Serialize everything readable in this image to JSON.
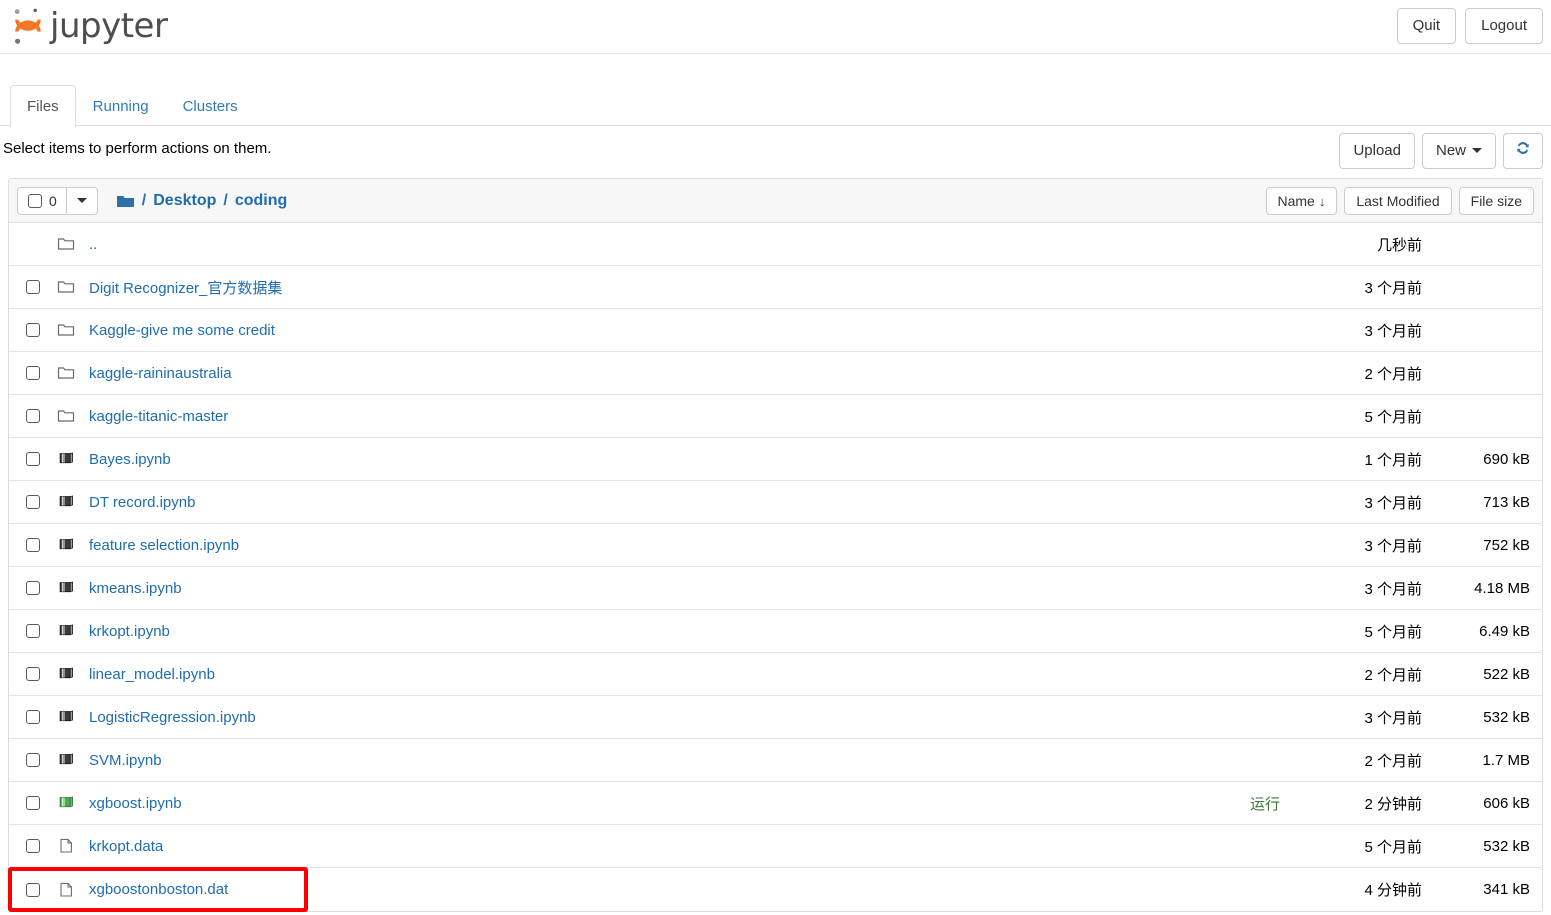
{
  "header": {
    "brand": "jupyter",
    "logo_color": "#f37726",
    "quit_label": "Quit",
    "logout_label": "Logout"
  },
  "tabs": [
    {
      "label": "Files",
      "active": true
    },
    {
      "label": "Running",
      "active": false
    },
    {
      "label": "Clusters",
      "active": false
    }
  ],
  "action_bar": {
    "message": "Select items to perform actions on them.",
    "upload_label": "Upload",
    "new_label": "New",
    "refresh_icon": "refresh-icon"
  },
  "list_toolbar": {
    "select_count": "0",
    "select_checkbox_icon": "checkbox-icon",
    "dropdown_icon": "chevron-down-icon",
    "breadcrumb": {
      "home_icon": "folder-icon",
      "items": [
        "Desktop",
        "coding"
      ],
      "separator": "/"
    },
    "sort_buttons": [
      {
        "label": "Name",
        "arrow": "↓"
      },
      {
        "label": "Last Modified",
        "arrow": ""
      },
      {
        "label": "File size",
        "arrow": ""
      }
    ]
  },
  "colors": {
    "link": "#1f6cb0",
    "running": "#3c763d",
    "highlight": "#ff0000",
    "notebook_icon": "#3b3b3b",
    "notebook_running_icon": "#4caf50",
    "brand_orange": "#f37726"
  },
  "files": [
    {
      "checkbox": false,
      "icon": "folder-icon",
      "name": "..",
      "running": "",
      "modified": "几秒前",
      "size": "",
      "parent": true,
      "highlighted": false
    },
    {
      "checkbox": true,
      "icon": "folder-icon",
      "name": "Digit Recognizer_官方数据集",
      "running": "",
      "modified": "3 个月前",
      "size": "",
      "parent": false,
      "highlighted": false
    },
    {
      "checkbox": true,
      "icon": "folder-icon",
      "name": "Kaggle-give me some credit",
      "running": "",
      "modified": "3 个月前",
      "size": "",
      "parent": false,
      "highlighted": false
    },
    {
      "checkbox": true,
      "icon": "folder-icon",
      "name": "kaggle-raininaustralia",
      "running": "",
      "modified": "2 个月前",
      "size": "",
      "parent": false,
      "highlighted": false
    },
    {
      "checkbox": true,
      "icon": "folder-icon",
      "name": "kaggle-titanic-master",
      "running": "",
      "modified": "5 个月前",
      "size": "",
      "parent": false,
      "highlighted": false
    },
    {
      "checkbox": true,
      "icon": "notebook-icon",
      "name": "Bayes.ipynb",
      "running": "",
      "modified": "1 个月前",
      "size": "690 kB",
      "parent": false,
      "highlighted": false
    },
    {
      "checkbox": true,
      "icon": "notebook-icon",
      "name": "DT record.ipynb",
      "running": "",
      "modified": "3 个月前",
      "size": "713 kB",
      "parent": false,
      "highlighted": false
    },
    {
      "checkbox": true,
      "icon": "notebook-icon",
      "name": "feature selection.ipynb",
      "running": "",
      "modified": "3 个月前",
      "size": "752 kB",
      "parent": false,
      "highlighted": false
    },
    {
      "checkbox": true,
      "icon": "notebook-icon",
      "name": "kmeans.ipynb",
      "running": "",
      "modified": "3 个月前",
      "size": "4.18 MB",
      "parent": false,
      "highlighted": false
    },
    {
      "checkbox": true,
      "icon": "notebook-icon",
      "name": "krkopt.ipynb",
      "running": "",
      "modified": "5 个月前",
      "size": "6.49 kB",
      "parent": false,
      "highlighted": false
    },
    {
      "checkbox": true,
      "icon": "notebook-icon",
      "name": "linear_model.ipynb",
      "running": "",
      "modified": "2 个月前",
      "size": "522 kB",
      "parent": false,
      "highlighted": false
    },
    {
      "checkbox": true,
      "icon": "notebook-icon",
      "name": "LogisticRegression.ipynb",
      "running": "",
      "modified": "3 个月前",
      "size": "532 kB",
      "parent": false,
      "highlighted": false
    },
    {
      "checkbox": true,
      "icon": "notebook-icon",
      "name": "SVM.ipynb",
      "running": "",
      "modified": "2 个月前",
      "size": "1.7 MB",
      "parent": false,
      "highlighted": false
    },
    {
      "checkbox": true,
      "icon": "notebook-running-icon",
      "name": "xgboost.ipynb",
      "running": "运行",
      "modified": "2 分钟前",
      "size": "606 kB",
      "parent": false,
      "highlighted": false
    },
    {
      "checkbox": true,
      "icon": "file-icon",
      "name": "krkopt.data",
      "running": "",
      "modified": "5 个月前",
      "size": "532 kB",
      "parent": false,
      "highlighted": false
    },
    {
      "checkbox": true,
      "icon": "file-icon",
      "name": "xgboostonboston.dat",
      "running": "",
      "modified": "4 分钟前",
      "size": "341 kB",
      "parent": false,
      "highlighted": true
    }
  ]
}
